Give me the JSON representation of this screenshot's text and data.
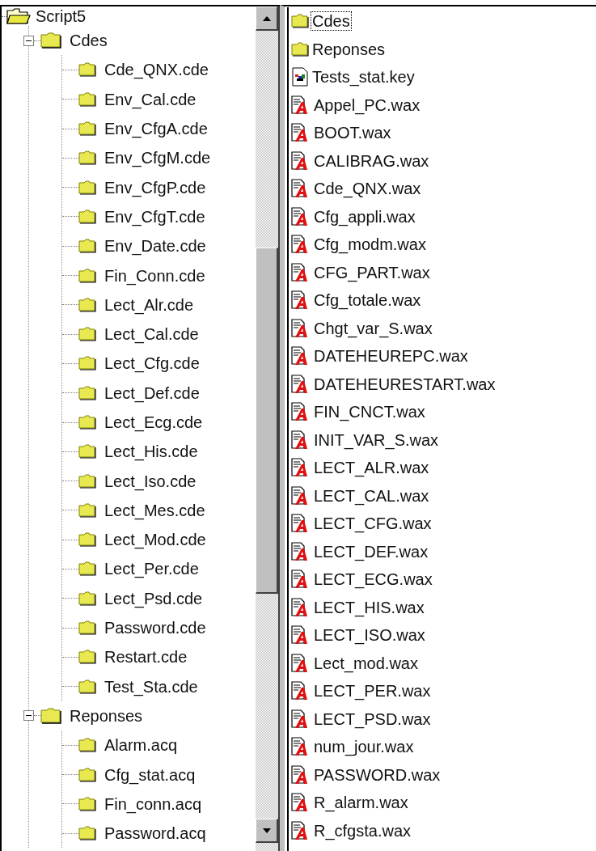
{
  "tree": {
    "label": "Script5",
    "children": [
      {
        "label": "Cdes",
        "expanded": true,
        "children": [
          {
            "label": "Cde_QNX.cde"
          },
          {
            "label": "Env_Cal.cde"
          },
          {
            "label": "Env_CfgA.cde"
          },
          {
            "label": "Env_CfgM.cde"
          },
          {
            "label": "Env_CfgP.cde"
          },
          {
            "label": "Env_CfgT.cde"
          },
          {
            "label": "Env_Date.cde"
          },
          {
            "label": "Fin_Conn.cde"
          },
          {
            "label": "Lect_Alr.cde"
          },
          {
            "label": "Lect_Cal.cde"
          },
          {
            "label": "Lect_Cfg.cde"
          },
          {
            "label": "Lect_Def.cde"
          },
          {
            "label": "Lect_Ecg.cde"
          },
          {
            "label": "Lect_His.cde"
          },
          {
            "label": "Lect_Iso.cde"
          },
          {
            "label": "Lect_Mes.cde"
          },
          {
            "label": "Lect_Mod.cde"
          },
          {
            "label": "Lect_Per.cde"
          },
          {
            "label": "Lect_Psd.cde"
          },
          {
            "label": "Password.cde"
          },
          {
            "label": "Restart.cde"
          },
          {
            "label": "Test_Sta.cde"
          }
        ]
      },
      {
        "label": "Reponses",
        "expanded": true,
        "children": [
          {
            "label": "Alarm.acq"
          },
          {
            "label": "Cfg_stat.acq"
          },
          {
            "label": "Fin_conn.acq"
          },
          {
            "label": "Password.acq"
          }
        ]
      }
    ]
  },
  "files": [
    {
      "name": "Cdes",
      "kind": "folder",
      "selected": true
    },
    {
      "name": "Reponses",
      "kind": "folder",
      "selected": false
    },
    {
      "name": "Tests_stat.key",
      "kind": "key",
      "selected": false
    },
    {
      "name": "Appel_PC.wax",
      "kind": "wax",
      "selected": false
    },
    {
      "name": "BOOT.wax",
      "kind": "wax",
      "selected": false
    },
    {
      "name": "CALIBRAG.wax",
      "kind": "wax",
      "selected": false
    },
    {
      "name": "Cde_QNX.wax",
      "kind": "wax",
      "selected": false
    },
    {
      "name": "Cfg_appli.wax",
      "kind": "wax",
      "selected": false
    },
    {
      "name": "Cfg_modm.wax",
      "kind": "wax",
      "selected": false
    },
    {
      "name": "CFG_PART.wax",
      "kind": "wax",
      "selected": false
    },
    {
      "name": "Cfg_totale.wax",
      "kind": "wax",
      "selected": false
    },
    {
      "name": "Chgt_var_S.wax",
      "kind": "wax",
      "selected": false
    },
    {
      "name": "DATEHEUREPC.wax",
      "kind": "wax",
      "selected": false
    },
    {
      "name": "DATEHEURESTART.wax",
      "kind": "wax",
      "selected": false
    },
    {
      "name": "FIN_CNCT.wax",
      "kind": "wax",
      "selected": false
    },
    {
      "name": "INIT_VAR_S.wax",
      "kind": "wax",
      "selected": false
    },
    {
      "name": "LECT_ALR.wax",
      "kind": "wax",
      "selected": false
    },
    {
      "name": "LECT_CAL.wax",
      "kind": "wax",
      "selected": false
    },
    {
      "name": "LECT_CFG.wax",
      "kind": "wax",
      "selected": false
    },
    {
      "name": "LECT_DEF.wax",
      "kind": "wax",
      "selected": false
    },
    {
      "name": "LECT_ECG.wax",
      "kind": "wax",
      "selected": false
    },
    {
      "name": "LECT_HIS.wax",
      "kind": "wax",
      "selected": false
    },
    {
      "name": "LECT_ISO.wax",
      "kind": "wax",
      "selected": false
    },
    {
      "name": "Lect_mod.wax",
      "kind": "wax",
      "selected": false
    },
    {
      "name": "LECT_PER.wax",
      "kind": "wax",
      "selected": false
    },
    {
      "name": "LECT_PSD.wax",
      "kind": "wax",
      "selected": false
    },
    {
      "name": "num_jour.wax",
      "kind": "wax",
      "selected": false
    },
    {
      "name": "PASSWORD.wax",
      "kind": "wax",
      "selected": false
    },
    {
      "name": "R_alarm.wax",
      "kind": "wax",
      "selected": false
    },
    {
      "name": "R_cfgsta.wax",
      "kind": "wax",
      "selected": false
    }
  ]
}
